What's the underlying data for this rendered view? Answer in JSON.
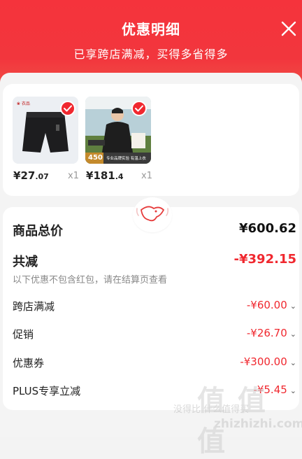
{
  "header": {
    "title": "优惠明细",
    "subtitle": "已享跨店满减，买得多省得多",
    "close_icon": "close-icon",
    "colors": {
      "background": "#f23a3e",
      "text": "#ffffff"
    }
  },
  "products": [
    {
      "price_symbol": "¥",
      "price_int": "27",
      "price_dec": ".07",
      "quantity": "x1",
      "selected": true,
      "image": "black-shorts-product-image"
    },
    {
      "price_symbol": "¥",
      "price_int": "181",
      "price_dec": ".4",
      "quantity": "x1",
      "selected": true,
      "image": "man-in-black-jacket-product-image",
      "image_badge": "450",
      "image_caption": "专业品牌实验 有温上衣"
    }
  ],
  "summary": {
    "total_label": "商品总价",
    "total_value": "¥600.62",
    "discount_label": "共减",
    "discount_value": "-¥392.15",
    "note": "以下优惠不包含红包，请在结算页查看",
    "items": [
      {
        "label": "跨店满减",
        "value": "-¥60.00"
      },
      {
        "label": "促销",
        "value": "-¥26.70"
      },
      {
        "label": "优惠券",
        "value": "-¥300.00"
      },
      {
        "label": "PLUS专享立减",
        "value": "-¥5.45"
      }
    ]
  },
  "watermark": {
    "text_cn": "值 值 值",
    "text_sub": "没得比 什么值得买",
    "text_url": "zhizhizhi.com"
  },
  "colors": {
    "accent": "#f0282f",
    "card": "#ffffff",
    "page": "#f4f4f4"
  }
}
